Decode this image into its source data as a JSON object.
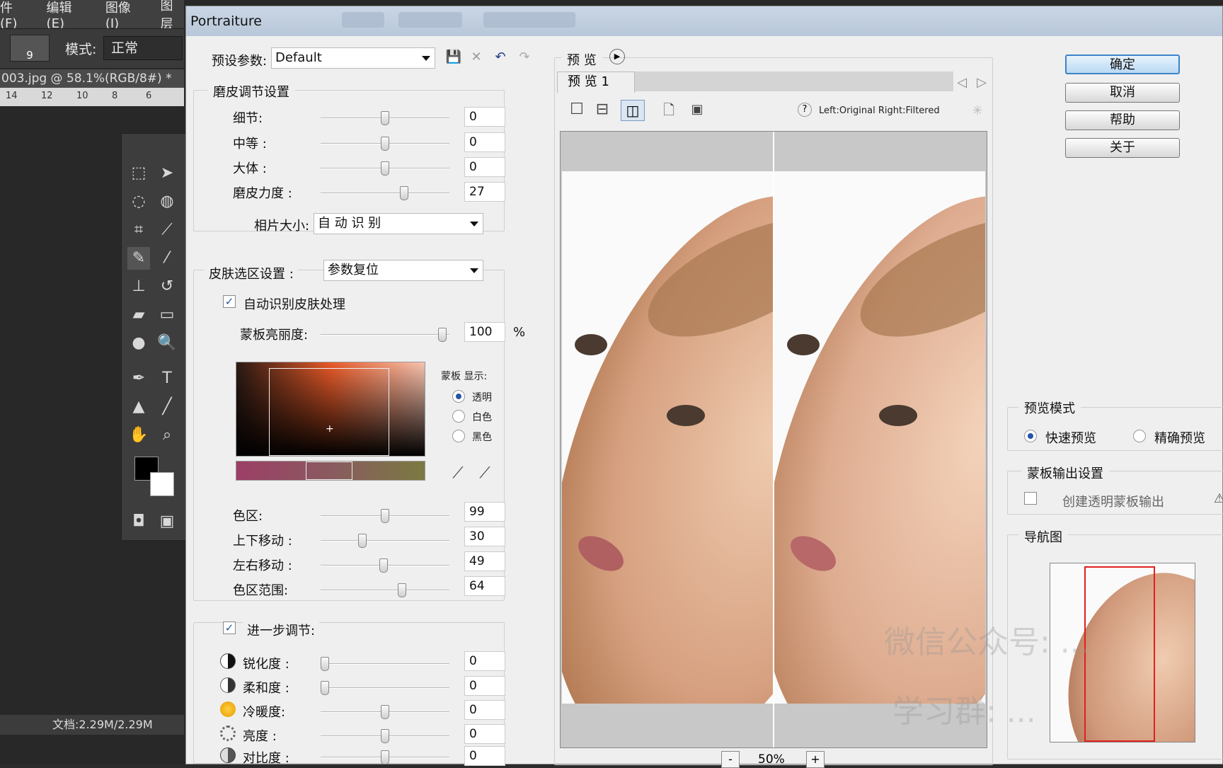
{
  "photoshop": {
    "menu": [
      "件(F)",
      "编辑(E)",
      "图像(I)",
      "图层"
    ],
    "brush_size": "9",
    "mode_label": "模式:",
    "mode_value": "正常",
    "doc_tab": "003.jpg @ 58.1%(RGB/8#) *",
    "doc_tab_close": "×",
    "ruler_ticks": [
      "14",
      "12",
      "10",
      "8",
      "6"
    ],
    "status": "文档:2.29M/2.29M"
  },
  "dialog": {
    "title": "Portraiture",
    "preset": {
      "label": "预设参数:",
      "value": "Default"
    },
    "smoothing": {
      "title": "磨皮调节设置",
      "rows": [
        {
          "label": "细节:",
          "value": "0",
          "level": 0.5
        },
        {
          "label": "中等 :",
          "value": "0",
          "level": 0.5
        },
        {
          "label": "大体 :",
          "value": "0",
          "level": 0.5
        },
        {
          "label": "磨皮力度 :",
          "value": "27",
          "level": 0.66
        }
      ],
      "photo_size_label": "相片大小:",
      "photo_size_value": "自 动 识 别"
    },
    "skin": {
      "title": "皮肤选区设置 :",
      "preset": "参数复位",
      "auto_label": "自动识别皮肤处理",
      "mask_brightness_label": "蒙板亮丽度:",
      "mask_brightness_value": "100",
      "percent": "%",
      "mask_display_label": "蒙板 显示:",
      "mask_display_options": [
        "透明",
        "白色",
        "黑色"
      ],
      "rows": [
        {
          "label": "色区:",
          "value": "99",
          "level": 0.5
        },
        {
          "label": "上下移动 :",
          "value": "30",
          "level": 0.31
        },
        {
          "label": "左右移动 :",
          "value": "49",
          "level": 0.49
        },
        {
          "label": "色区范围:",
          "value": "64",
          "level": 0.64
        }
      ]
    },
    "enhance": {
      "title": "进一步调节:",
      "rows": [
        {
          "label": "锐化度 :",
          "value": "0",
          "level": 0.0
        },
        {
          "label": "柔和度 :",
          "value": "0",
          "level": 0.0
        },
        {
          "label": "冷暖度:",
          "value": "0",
          "level": 0.5
        },
        {
          "label": "亮度 :",
          "value": "0",
          "level": 0.5
        },
        {
          "label": "对比度 :",
          "value": "0",
          "level": 0.5
        }
      ]
    },
    "preview": {
      "label": "预 览",
      "tab": "预 览  1",
      "split_label": "Left:Original Right:Filtered",
      "help": "?",
      "zoom": "50%",
      "zoom_out": "-",
      "zoom_in": "+"
    },
    "buttons": {
      "ok": "确定",
      "cancel": "取消",
      "help": "帮助",
      "about": "关于"
    },
    "preview_mode": {
      "title": "预览模式",
      "fast": "快速预览",
      "precise": "精确预览"
    },
    "mask_output": {
      "title": "蒙板输出设置",
      "create": "创建透明蒙板输出"
    },
    "navigator": {
      "title": "导航图"
    },
    "watermark": {
      "line1": "微信公众号: ...",
      "line2": "学习群: ..."
    }
  },
  "colors": {
    "accent": "#2255aa",
    "dialog_bg": "#efefef",
    "nav_frame": "#e02020"
  }
}
